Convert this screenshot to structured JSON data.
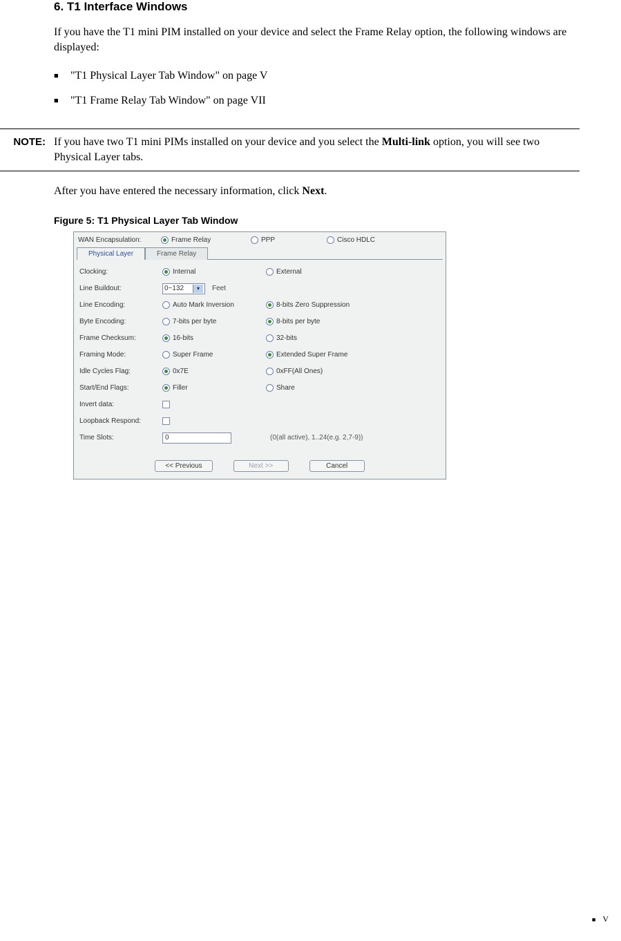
{
  "heading": "6. T1 Interface Windows",
  "intro": "If you have the T1 mini PIM installed on your device and select the Frame Relay option, the following windows are displayed:",
  "bullets": [
    "\"T1 Physical Layer Tab Window\" on page V",
    "\"T1 Frame Relay Tab Window\" on page VII"
  ],
  "note": {
    "label": "NOTE:",
    "pre": "If you have two T1 mini PIMs installed on your device and you select the ",
    "bold": "Multi-link",
    "post": " option, you will see two Physical Layer tabs."
  },
  "after_pre": "After you have entered the necessary information, click ",
  "after_bold": "Next",
  "after_post": ".",
  "fig_caption": "Figure 5:  T1 Physical Layer Tab Window",
  "panel": {
    "wan_label": "WAN Encapsulation:",
    "wan_opts": [
      {
        "label": "Frame Relay",
        "sel": true
      },
      {
        "label": "PPP",
        "sel": false
      },
      {
        "label": "Cisco HDLC",
        "sel": false
      }
    ],
    "tabs": [
      {
        "label": "Physical Layer",
        "active": true
      },
      {
        "label": "Frame Relay",
        "active": false
      }
    ],
    "rows": {
      "clocking": {
        "label": "Clocking:",
        "o1": "Internal",
        "o2": "External",
        "sel": "o1"
      },
      "line_buildout": {
        "label": "Line Buildout:",
        "select": "0~132",
        "unit": "Feet"
      },
      "line_encoding": {
        "label": "Line Encoding:",
        "o1": "Auto Mark Inversion",
        "o2": "8-bits Zero Suppression",
        "sel": "o2"
      },
      "byte_encoding": {
        "label": "Byte Encoding:",
        "o1": "7-bits per byte",
        "o2": "8-bits per byte",
        "sel": "o2"
      },
      "frame_checksum": {
        "label": "Frame Checksum:",
        "o1": "16-bits",
        "o2": "32-bits",
        "sel": "o1"
      },
      "framing_mode": {
        "label": "Framing Mode:",
        "o1": "Super Frame",
        "o2": "Extended Super Frame",
        "sel": "o2"
      },
      "idle_cycles": {
        "label": "Idle Cycles Flag:",
        "o1": "0x7E",
        "o2": "0xFF(All Ones)",
        "sel": "o1"
      },
      "start_end": {
        "label": "Start/End Flags:",
        "o1": "Filler",
        "o2": "Share",
        "sel": "o1"
      },
      "invert_data": {
        "label": "Invert data:"
      },
      "loopback": {
        "label": "Loopback Respond:"
      },
      "time_slots": {
        "label": "Time Slots:",
        "value": "0",
        "hint": "(0(all active), 1..24(e.g. 2,7-9))"
      }
    },
    "buttons": {
      "prev": "<< Previous",
      "next": "Next >>",
      "cancel": "Cancel"
    }
  },
  "footer": {
    "mark": "V"
  }
}
